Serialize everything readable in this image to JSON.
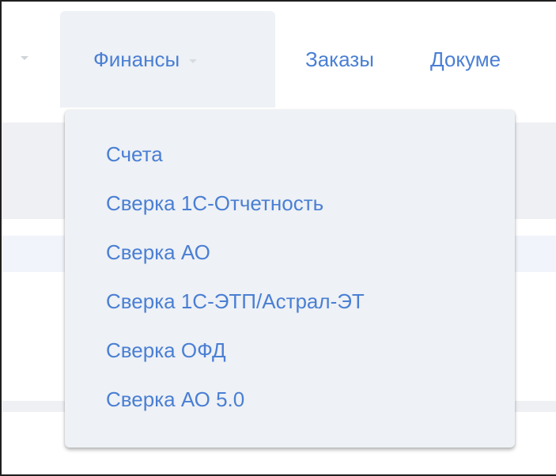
{
  "menubar": {
    "tabs": [
      {
        "label": "Финансы",
        "active": true
      },
      {
        "label": "Заказы",
        "active": false
      },
      {
        "label": "Докуме",
        "active": false
      }
    ]
  },
  "dropdown": {
    "items": [
      {
        "label": "Счета"
      },
      {
        "label": "Сверка 1С-Отчетность"
      },
      {
        "label": "Сверка АО"
      },
      {
        "label": "Сверка 1С-ЭТП/Астрал-ЭТ"
      },
      {
        "label": "Сверка ОФД"
      },
      {
        "label": "Сверка АО 5.0"
      }
    ]
  },
  "colors": {
    "link": "#4a7fd4",
    "menu_bg": "#eef1f5"
  }
}
